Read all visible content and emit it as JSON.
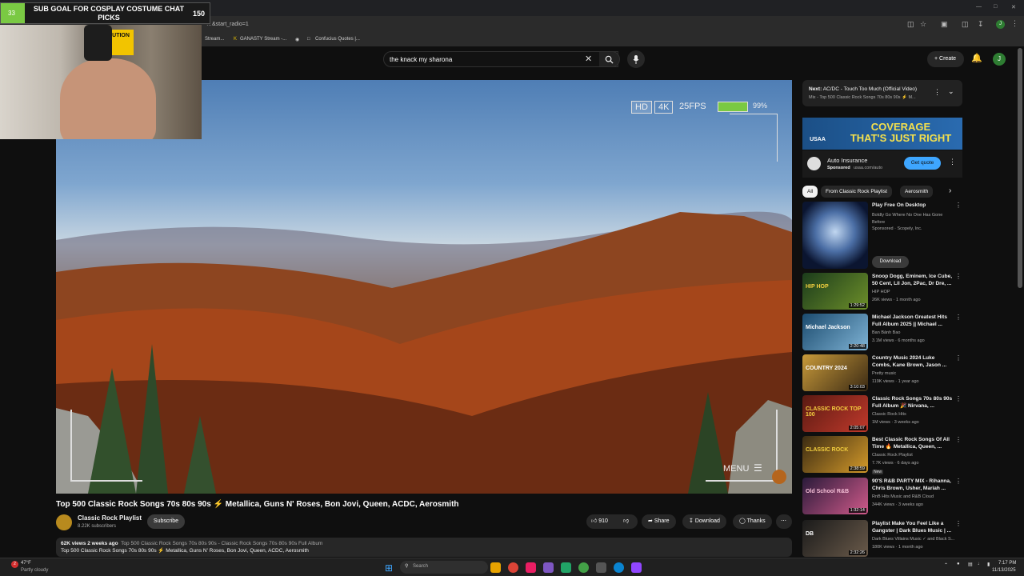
{
  "browser": {
    "address": "…&start_radio=1",
    "bookmarks": [
      "Stream...",
      "GANASTY Stream -...",
      "Confucius Quotes |..."
    ]
  },
  "stream_overlay": {
    "sub_count_left": "33",
    "goal_text": "SUB GOAL FOR COSPLAY COSTUME CHAT PICKS",
    "goal_target": "150",
    "webcam_sign": "CAUTION"
  },
  "search": {
    "value": "the knack my sharona"
  },
  "header": {
    "create_label": "Create",
    "avatar_letter": "J"
  },
  "video": {
    "hud_hd": "HD",
    "hud_4k": "4K",
    "hud_fps": "25FPS",
    "hud_battery": "99%",
    "hud_menu": "MENU",
    "title": "Top 500 Classic Rock Songs 70s 80s 90s ⚡ Metallica, Guns N' Roses, Bon Jovi, Queen, ACDC, Aerosmith"
  },
  "channel": {
    "name": "Classic Rock Playlist",
    "subscribers": "8.22K subscribers",
    "subscribe_label": "Subscribe"
  },
  "actions": {
    "likes": "910",
    "share": "Share",
    "download": "Download",
    "thanks": "Thanks"
  },
  "description": {
    "stats": "62K views  2 weeks ago",
    "tags": "Top 500 Classic Rock Songs 70s 80s 90s - Classic Rock Songs 70s 80s 90s Full Album",
    "line2": "Top 500 Classic Rock Songs 70s 80s 90s ⚡ Metallica, Guns N' Roses, Bon Jovi, Queen, ACDC, Aerosmith"
  },
  "next_up": {
    "label": "Next:",
    "title": "AC/DC - Touch Too Much (Official Video)",
    "mix": "Mix - Top 500 Classic Rock Songs 70s 80s 90s ⚡ M..."
  },
  "ad": {
    "brand": "USAA",
    "headline_1": "COVERAGE",
    "headline_2": "THAT'S JUST RIGHT",
    "title": "Auto Insurance",
    "sponsored": "Sponsored",
    "domain": "usaa.com/auto",
    "cta": "Get quote"
  },
  "chips": [
    "All",
    "From Classic Rock Playlist",
    "Aerosmith"
  ],
  "recommendations": [
    {
      "title": "Play Free On Desktop",
      "line1": "Boldly Go Where No One Has Gone Before",
      "line2": "Sponsored · Scopely, Inc.",
      "button": "Download",
      "duration": ""
    },
    {
      "title": "Snoop Dogg, Eminem, Ice Cube, 50 Cent, Lil Jon, 2Pac, Dr Dre, ...",
      "line1": "HIP HOP",
      "line2": "26K views · 1 month ago",
      "duration": "1:29:52"
    },
    {
      "title": "Michael Jackson Greatest Hits Full Album 2025 || Michael ...",
      "line1": "Ban Bánh Bao",
      "line2": "3.1M views · 6 months ago",
      "duration": "2:20:48"
    },
    {
      "title": "Country Music 2024 Luke Combs, Kane Brown, Jason ...",
      "line1": "Pretty music",
      "line2": "119K views · 1 year ago",
      "duration": "3:10:03"
    },
    {
      "title": "Classic Rock Songs 70s 80s 90s Full Album 🎉 Nirvana, ...",
      "line1": "Classic Rock Hits",
      "line2": "1M views · 3 weeks ago",
      "duration": "2:05:07"
    },
    {
      "title": "Best Classic Rock Songs Of All Time 🔥 Metallica, Queen, ...",
      "line1": "Classic Rock Playlist",
      "line2": "7.7K views · 6 days ago",
      "badge": "New",
      "duration": "2:38:59"
    },
    {
      "title": "90'S R&B PARTY MIX - Rihanna, Chris Brown, Usher, Mariah ...",
      "line1": "RnB Hits Music and R&B Cloud",
      "line2": "344K views · 3 weeks ago",
      "duration": "1:32:14"
    },
    {
      "title": "Playlist Make You Feel Like a Gangster | Dark Blues Music | ...",
      "line1": "Dark Blues Villains Music ✓ and Black S...",
      "line2": "180K views · 1 month ago",
      "duration": "2:32:26"
    }
  ],
  "thumb_texts": [
    "HIP HOP",
    "Michael Jackson",
    "COUNTRY 2024",
    "CLASSIC ROCK TOP 100",
    "CLASSIC ROCK",
    "Old School R&B",
    "DB"
  ],
  "taskbar": {
    "weather_temp": "47°F",
    "weather_desc": "Partly cloudy",
    "search_placeholder": "Search",
    "time": "7:17 PM",
    "date": "11/13/2025"
  },
  "colors": {
    "accent_blue": "#3ea6ff",
    "sub_green": "#7ac943",
    "usaa_yellow": "#f4e04d"
  }
}
